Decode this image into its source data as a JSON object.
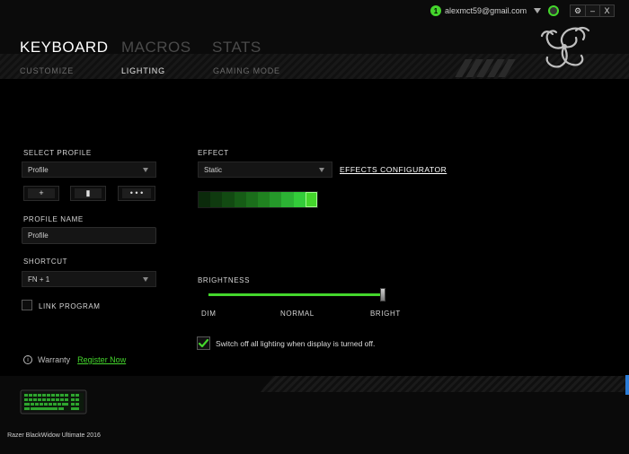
{
  "header": {
    "account": {
      "badge": "1",
      "email": "alexmct59@gmail.com"
    },
    "window_controls": [
      "⚙",
      "–",
      "X"
    ],
    "main_tabs": [
      "KEYBOARD",
      "MACROS",
      "STATS"
    ],
    "active_main_tab": 0,
    "sub_tabs": [
      "CUSTOMIZE",
      "LIGHTING",
      "GAMING MODE"
    ],
    "active_sub_tab": 1
  },
  "profile": {
    "select_label": "SELECT PROFILE",
    "selected_profile": "Profile",
    "add_label": "+",
    "delete_label": "▮",
    "more_label": "• • •",
    "name_label": "PROFILE NAME",
    "name_value": "Profile",
    "shortcut_label": "SHORTCUT",
    "shortcut_value": "FN + 1",
    "link_program_label": "LINK PROGRAM",
    "link_program_checked": false
  },
  "warranty": {
    "label": "Warranty",
    "register_label": "Register Now"
  },
  "effect": {
    "label": "EFFECT",
    "selected": "Static",
    "configurator_link": "EFFECTS CONFIGURATOR",
    "swatch_colors": [
      "#0b2a0b",
      "#0f3a0f",
      "#124a12",
      "#165c16",
      "#1b6e1b",
      "#208220",
      "#25982a",
      "#2cb234",
      "#33cc3a",
      "#44d62c"
    ],
    "selected_swatch": 9
  },
  "brightness": {
    "label": "BRIGHTNESS",
    "value_fraction": 1.0,
    "ticks": [
      "DIM",
      "NORMAL",
      "BRIGHT"
    ]
  },
  "display_off_option": {
    "checked": true,
    "label": "Switch off all lighting when display is turned off."
  },
  "device": {
    "name": "Razer BlackWidow Ultimate 2016"
  },
  "colors": {
    "accent": "#44d62c",
    "background": "#000000"
  }
}
